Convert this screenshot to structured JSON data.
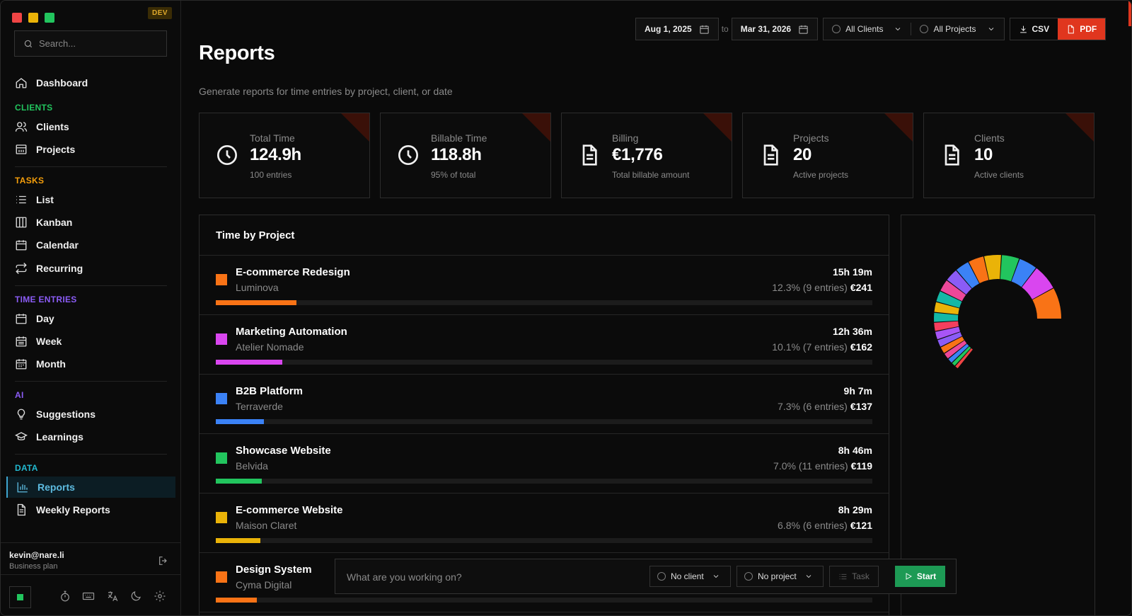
{
  "window": {
    "dev_badge": "DEV",
    "traffic_colors": [
      "#ef4444",
      "#eab308",
      "#22c55e"
    ]
  },
  "sidebar": {
    "search_placeholder": "Search...",
    "dashboard": "Dashboard",
    "sections": {
      "clients": {
        "label": "CLIENTS",
        "color": "#22c55e"
      },
      "tasks": {
        "label": "TASKS",
        "color": "#f59e0b"
      },
      "time_entries": {
        "label": "TIME ENTRIES",
        "color": "#8b5cf6"
      },
      "ai": {
        "label": "AI",
        "color": "#8b5cf6"
      },
      "data": {
        "label": "DATA",
        "color": "#22b8cf"
      }
    },
    "items": {
      "clients": "Clients",
      "projects": "Projects",
      "list": "List",
      "kanban": "Kanban",
      "calendar": "Calendar",
      "recurring": "Recurring",
      "day": "Day",
      "week": "Week",
      "month": "Month",
      "suggestions": "Suggestions",
      "learnings": "Learnings",
      "reports": "Reports",
      "weekly_reports": "Weekly Reports"
    },
    "user": {
      "email": "kevin@nare.li",
      "plan": "Business plan"
    }
  },
  "header": {
    "title": "Reports",
    "subtitle": "Generate reports for time entries by project, client, or date",
    "date_from": "Aug 1, 2025",
    "date_sep": "to",
    "date_to": "Mar 31, 2026",
    "client_filter": "All Clients",
    "project_filter": "All Projects",
    "csv": "CSV",
    "pdf": "PDF"
  },
  "stats": [
    {
      "label": "Total Time",
      "value": "124.9h",
      "sub": "100 entries",
      "icon": "clock-icon"
    },
    {
      "label": "Billable Time",
      "value": "118.8h",
      "sub": "95% of total",
      "icon": "clock-icon"
    },
    {
      "label": "Billing",
      "value": "€1,776",
      "sub": "Total billable amount",
      "icon": "document-icon"
    },
    {
      "label": "Projects",
      "value": "20",
      "sub": "Active projects",
      "icon": "document-icon"
    },
    {
      "label": "Clients",
      "value": "10",
      "sub": "Active clients",
      "icon": "document-icon"
    }
  ],
  "time_by_project": {
    "title": "Time by Project",
    "rows": [
      {
        "name": "E-commerce Redesign",
        "client": "Luminova",
        "time": "15h 19m",
        "share": "12.3% (9 entries)",
        "amount": "€241",
        "color": "#f97316",
        "fill": 0.123
      },
      {
        "name": "Marketing Automation",
        "client": "Atelier Nomade",
        "time": "12h 36m",
        "share": "10.1% (7 entries)",
        "amount": "€162",
        "color": "#d946ef",
        "fill": 0.101
      },
      {
        "name": "B2B Platform",
        "client": "Terraverde",
        "time": "9h 7m",
        "share": "7.3% (6 entries)",
        "amount": "€137",
        "color": "#3b82f6",
        "fill": 0.073
      },
      {
        "name": "Showcase Website",
        "client": "Belvida",
        "time": "8h 46m",
        "share": "7.0% (11 entries)",
        "amount": "€119",
        "color": "#22c55e",
        "fill": 0.07
      },
      {
        "name": "E-commerce Website",
        "client": "Maison Claret",
        "time": "8h 29m",
        "share": "6.8% (6 entries)",
        "amount": "€121",
        "color": "#eab308",
        "fill": 0.068
      },
      {
        "name": "Design System",
        "client": "Cyma Digital",
        "time": "",
        "share": "",
        "amount": "",
        "color": "#f97316",
        "fill": 0.062
      }
    ]
  },
  "donut": {
    "segment_colors": [
      "#f97316",
      "#d946ef",
      "#3b82f6",
      "#22c55e",
      "#eab308",
      "#f97316",
      "#3b82f6",
      "#8b5cf6",
      "#ec4899",
      "#14b8a6",
      "#eab308",
      "#14b8a6",
      "#f43f5e",
      "#a855f7",
      "#8b5cf6",
      "#f97316",
      "#ec4899",
      "#3b82f6",
      "#22c55e",
      "#ef4444"
    ],
    "segment_values": [
      12.3,
      10.1,
      7.3,
      7.0,
      6.8,
      6.2,
      5.6,
      5.2,
      4.8,
      4.4,
      4.1,
      3.8,
      3.5,
      3.3,
      3.0,
      2.8,
      2.5,
      2.1,
      1.7,
      1.5
    ]
  },
  "timer": {
    "placeholder": "What are you working on?",
    "client": "No client",
    "project": "No project",
    "task": "Task",
    "start": "Start"
  }
}
